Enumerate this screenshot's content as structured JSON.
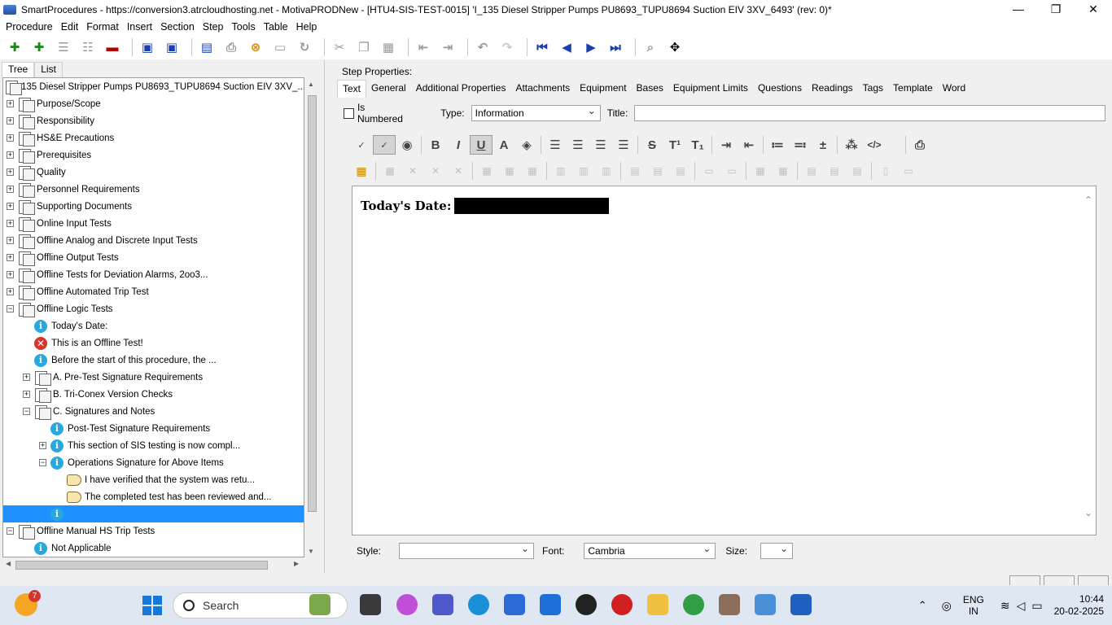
{
  "window": {
    "title": "SmartProcedures - https://conversion3.atrcloudhosting.net - MotivaPRODNew - [HTU4-SIS-TEST-0015] 'I_135 Diesel Stripper Pumps PU8693_TUPU8694 Suction EIV 3XV_6493' (rev: 0)*",
    "minimize": "—",
    "maximize": "❐",
    "close": "✕"
  },
  "menu": [
    "Procedure",
    "Edit",
    "Format",
    "Insert",
    "Section",
    "Step",
    "Tools",
    "Table",
    "Help"
  ],
  "left_tabs": [
    "Tree",
    "List"
  ],
  "tree": [
    {
      "label": "I_135  Diesel  Stripper  Pumps  PU8693_TUPU8694  Suction  EIV  3XV_...",
      "icon": "folder",
      "expander": "",
      "level": 0
    },
    {
      "label": "Purpose/Scope",
      "icon": "folder",
      "expander": "+",
      "level": 1
    },
    {
      "label": "Responsibility",
      "icon": "folder",
      "expander": "+",
      "level": 1
    },
    {
      "label": "HS&E Precautions",
      "icon": "folder",
      "expander": "+",
      "level": 1
    },
    {
      "label": "Prerequisites",
      "icon": "folder",
      "expander": "+",
      "level": 1
    },
    {
      "label": "Quality",
      "icon": "folder",
      "expander": "+",
      "level": 1
    },
    {
      "label": "Personnel Requirements",
      "icon": "folder",
      "expander": "+",
      "level": 1
    },
    {
      "label": "Supporting Documents",
      "icon": "folder",
      "expander": "+",
      "level": 1
    },
    {
      "label": "Online Input Tests",
      "icon": "folder",
      "expander": "+",
      "level": 1
    },
    {
      "label": "Offline Analog and Discrete Input Tests",
      "icon": "folder",
      "expander": "+",
      "level": 1
    },
    {
      "label": "Offline Output Tests",
      "icon": "folder",
      "expander": "+",
      "level": 1
    },
    {
      "label": "Offline Tests for Deviation Alarms, 2oo3...",
      "icon": "folder",
      "expander": "+",
      "level": 1
    },
    {
      "label": "Offline Automated Trip Test",
      "icon": "folder",
      "expander": "+",
      "level": 1
    },
    {
      "label": "Offline Logic Tests",
      "icon": "folder",
      "expander": "−",
      "level": 1
    },
    {
      "label": "Today's Date:",
      "icon": "info",
      "expander": "",
      "level": 2
    },
    {
      "label": "This is an Offline Test!",
      "icon": "error",
      "expander": "",
      "level": 2
    },
    {
      "label": "Before the start of this procedure, the ...",
      "icon": "info",
      "expander": "",
      "level": 2
    },
    {
      "label": "A. Pre-Test Signature Requirements",
      "icon": "folder",
      "expander": "+",
      "level": 2
    },
    {
      "label": "B. Tri-Conex Version Checks",
      "icon": "folder",
      "expander": "+",
      "level": 2
    },
    {
      "label": "C. Signatures and Notes",
      "icon": "folder",
      "expander": "−",
      "level": 2
    },
    {
      "label": "Post-Test Signature Requirements",
      "icon": "info",
      "expander": "",
      "level": 3
    },
    {
      "label": "This section of SIS testing is now compl...",
      "icon": "info",
      "expander": "+",
      "level": 3
    },
    {
      "label": "Operations Signature for Above Items",
      "icon": "info",
      "expander": "−",
      "level": 3
    },
    {
      "label": "I have verified that the system was retu...",
      "icon": "hand",
      "expander": "",
      "level": 4
    },
    {
      "label": "The completed test has been reviewed and...",
      "icon": "hand",
      "expander": "",
      "level": 4
    },
    {
      "label": "",
      "icon": "info",
      "expander": "",
      "level": 3,
      "selected": true
    },
    {
      "label": "Offline Manual HS Trip Tests",
      "icon": "folder",
      "expander": "−",
      "level": 1
    },
    {
      "label": "Not Applicable",
      "icon": "info",
      "expander": "",
      "level": 2
    }
  ],
  "step_properties": {
    "label": "Step Properties:",
    "tabs": [
      "Text",
      "General",
      "Additional Properties",
      "Attachments",
      "Equipment",
      "Bases",
      "Equipment Limits",
      "Questions",
      "Readings",
      "Tags",
      "Template",
      "Word"
    ],
    "is_numbered_label": "Is Numbered",
    "type_label": "Type:",
    "type_value": "Information",
    "title_label": "Title:"
  },
  "editor": {
    "text": "Today's Date:"
  },
  "stylebar": {
    "style_label": "Style:",
    "style_value": "",
    "font_label": "Font:",
    "font_value": "Cambria",
    "size_label": "Size:",
    "size_value": ""
  },
  "taskbar": {
    "weather_badge": "7",
    "search_placeholder": "Search",
    "lang_line1": "ENG",
    "lang_line2": "IN",
    "time": "10:44",
    "date": "20-02-2025"
  },
  "colors": {
    "selection": "#1e90ff",
    "info": "#29a8e0",
    "error": "#d9342b",
    "taskbar": "#dfe7f3"
  }
}
